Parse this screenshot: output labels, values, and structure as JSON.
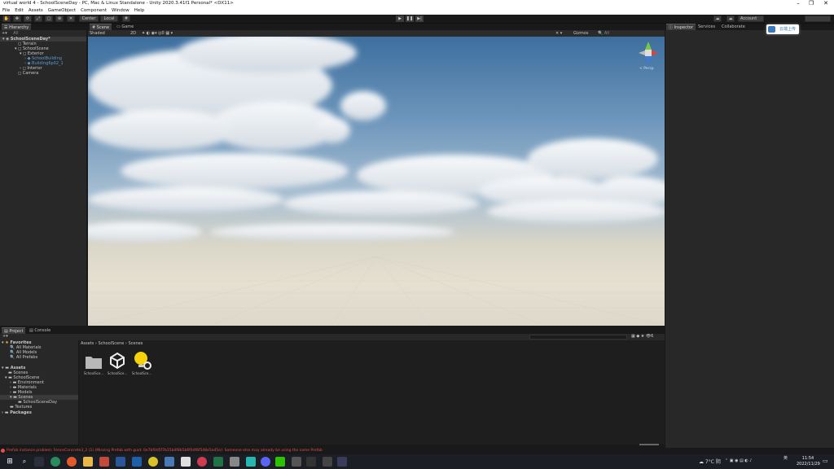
{
  "window": {
    "title": "virtual world 4 - SchoolSceneDay - PC, Mac & Linux Standalone - Unity 2020.3.41f1 Personal* <DX11>",
    "menu": [
      "File",
      "Edit",
      "Assets",
      "GameObject",
      "Component",
      "Window",
      "Help"
    ]
  },
  "toolbar": {
    "center_label": "Center",
    "local_label": "Local",
    "account_label": "Account",
    "cloud_badge": "云端上传"
  },
  "hierarchy": {
    "tab": "Hierarchy",
    "search_placeholder": "All",
    "rows": [
      {
        "label": "SchoolSceneDay*",
        "indent": 0,
        "blue": false
      },
      {
        "label": "Terrain",
        "indent": 2,
        "blue": false
      },
      {
        "label": "SchoolScene",
        "indent": 2,
        "blue": false
      },
      {
        "label": "Exterior",
        "indent": 3,
        "blue": false
      },
      {
        "label": "SchoolBuilding",
        "indent": 4,
        "blue": true
      },
      {
        "label": "Building6p02_1",
        "indent": 4,
        "blue": true
      },
      {
        "label": "Interior",
        "indent": 3,
        "blue": false
      },
      {
        "label": "Camera",
        "indent": 2,
        "blue": false
      }
    ]
  },
  "scene": {
    "tabs": [
      "Scene",
      "Game"
    ],
    "shading": "Shaded",
    "mode_2d": "2D",
    "gizmos": "Gizmos",
    "search_placeholder": "All",
    "persp_label": "< Persp"
  },
  "inspector": {
    "tabs": [
      "Inspector",
      "Services",
      "Collaborate"
    ]
  },
  "project": {
    "tabs": [
      "Project",
      "Console"
    ],
    "breadcrumb": [
      "Assets",
      "SchoolScene",
      "Scenes"
    ],
    "tree": [
      {
        "label": "Favorites",
        "indent": 0,
        "bold": true
      },
      {
        "label": "All Materials",
        "indent": 2,
        "bold": false
      },
      {
        "label": "All Models",
        "indent": 2,
        "bold": false
      },
      {
        "label": "All Prefabs",
        "indent": 2,
        "bold": false
      },
      {
        "label": "Assets",
        "indent": 0,
        "bold": true
      },
      {
        "label": "Scenes",
        "indent": 1,
        "bold": false
      },
      {
        "label": "SchoolScene",
        "indent": 1,
        "bold": false
      },
      {
        "label": "Environment",
        "indent": 2,
        "bold": false
      },
      {
        "label": "Materials",
        "indent": 2,
        "bold": false
      },
      {
        "label": "Models",
        "indent": 2,
        "bold": false
      },
      {
        "label": "Scenes",
        "indent": 2,
        "bold": false,
        "selected": true
      },
      {
        "label": "SchoolSceneDay",
        "indent": 3,
        "bold": false
      },
      {
        "label": "Textures",
        "indent": 2,
        "bold": false
      },
      {
        "label": "Packages",
        "indent": 0,
        "bold": true
      }
    ],
    "assets": [
      {
        "label": "SchoolSce...",
        "icon": "folder-icon"
      },
      {
        "label": "SchoolSce...",
        "icon": "unity-scene-icon"
      },
      {
        "label": "SchoolSce...",
        "icon": "lighting-settings-icon"
      }
    ],
    "count_badge": "6"
  },
  "status": {
    "message": "Prefab instance problem: FenceConcrete3_2 (1) (Missing Prefab with guid: 0e7bf0d5f7b15b4f8b5b6f0df6f5d8e5a45e): Someone else may already be using the same Prefab"
  },
  "taskbar": {
    "weather": "7°C 阴",
    "time": "11:54",
    "date": "2022/11/29",
    "ime": "英"
  },
  "colors": {
    "accent": "#3a79bb",
    "error": "#e05050",
    "panel": "#282828",
    "dark": "#191919"
  }
}
